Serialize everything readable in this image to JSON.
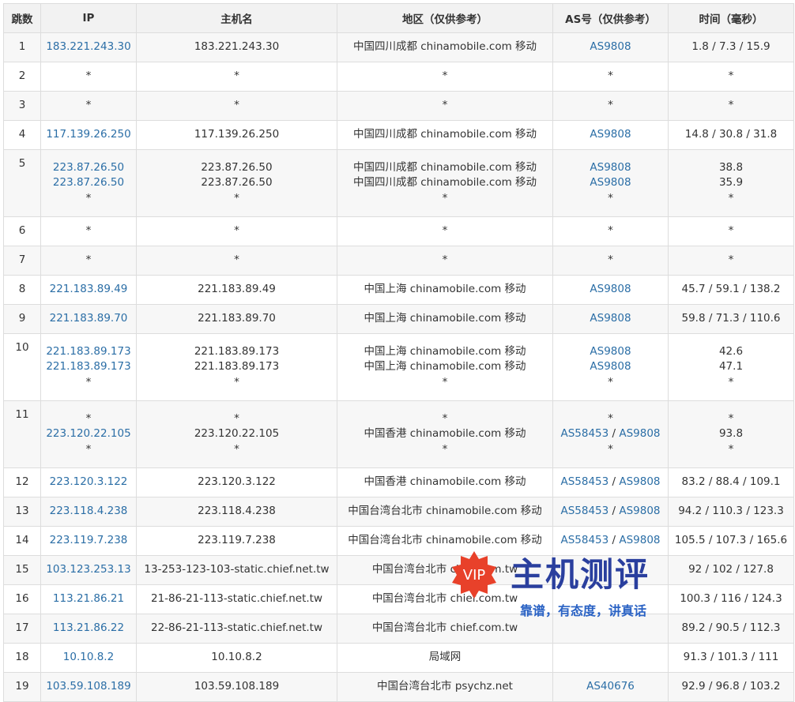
{
  "headers": [
    "跳数",
    "IP",
    "主机名",
    "地区（仅供参考）",
    "AS号（仅供参考）",
    "时间（毫秒）"
  ],
  "rows": [
    {
      "hop": "1",
      "ip": [
        "183.221.243.30"
      ],
      "host": [
        "183.221.243.30"
      ],
      "region": [
        "中国四川成都 chinamobile.com 移动"
      ],
      "as": [
        [
          "AS9808"
        ]
      ],
      "time": [
        "1.8 / 7.3 / 15.9"
      ]
    },
    {
      "hop": "2",
      "ip": [
        "*"
      ],
      "host": [
        "*"
      ],
      "region": [
        "*"
      ],
      "as": [
        [
          "*"
        ]
      ],
      "time": [
        "*"
      ]
    },
    {
      "hop": "3",
      "ip": [
        "*"
      ],
      "host": [
        "*"
      ],
      "region": [
        "*"
      ],
      "as": [
        [
          "*"
        ]
      ],
      "time": [
        "*"
      ]
    },
    {
      "hop": "4",
      "ip": [
        "117.139.26.250"
      ],
      "host": [
        "117.139.26.250"
      ],
      "region": [
        "中国四川成都 chinamobile.com 移动"
      ],
      "as": [
        [
          "AS9808"
        ]
      ],
      "time": [
        "14.8 / 30.8 / 31.8"
      ]
    },
    {
      "hop": "5",
      "ip": [
        "223.87.26.50",
        "223.87.26.50",
        "*"
      ],
      "host": [
        "223.87.26.50",
        "223.87.26.50",
        "*"
      ],
      "region": [
        "中国四川成都 chinamobile.com 移动",
        "中国四川成都 chinamobile.com 移动",
        "*"
      ],
      "as": [
        [
          "AS9808"
        ],
        [
          "AS9808"
        ],
        [
          "*"
        ]
      ],
      "time": [
        "38.8",
        "35.9",
        "*"
      ]
    },
    {
      "hop": "6",
      "ip": [
        "*"
      ],
      "host": [
        "*"
      ],
      "region": [
        "*"
      ],
      "as": [
        [
          "*"
        ]
      ],
      "time": [
        "*"
      ]
    },
    {
      "hop": "7",
      "ip": [
        "*"
      ],
      "host": [
        "*"
      ],
      "region": [
        "*"
      ],
      "as": [
        [
          "*"
        ]
      ],
      "time": [
        "*"
      ]
    },
    {
      "hop": "8",
      "ip": [
        "221.183.89.49"
      ],
      "host": [
        "221.183.89.49"
      ],
      "region": [
        "中国上海 chinamobile.com 移动"
      ],
      "as": [
        [
          "AS9808"
        ]
      ],
      "time": [
        "45.7 / 59.1 / 138.2"
      ]
    },
    {
      "hop": "9",
      "ip": [
        "221.183.89.70"
      ],
      "host": [
        "221.183.89.70"
      ],
      "region": [
        "中国上海 chinamobile.com 移动"
      ],
      "as": [
        [
          "AS9808"
        ]
      ],
      "time": [
        "59.8 / 71.3 / 110.6"
      ]
    },
    {
      "hop": "10",
      "ip": [
        "221.183.89.173",
        "221.183.89.173",
        "*"
      ],
      "host": [
        "221.183.89.173",
        "221.183.89.173",
        "*"
      ],
      "region": [
        "中国上海 chinamobile.com 移动",
        "中国上海 chinamobile.com 移动",
        "*"
      ],
      "as": [
        [
          "AS9808"
        ],
        [
          "AS9808"
        ],
        [
          "*"
        ]
      ],
      "time": [
        "42.6",
        "47.1",
        "*"
      ]
    },
    {
      "hop": "11",
      "ip": [
        "*",
        "223.120.22.105",
        "*"
      ],
      "host": [
        "*",
        "223.120.22.105",
        "*"
      ],
      "region": [
        "*",
        "中国香港 chinamobile.com 移动",
        "*"
      ],
      "as": [
        [
          "*"
        ],
        [
          "AS58453",
          "AS9808"
        ],
        [
          "*"
        ]
      ],
      "time": [
        "*",
        "93.8",
        "*"
      ]
    },
    {
      "hop": "12",
      "ip": [
        "223.120.3.122"
      ],
      "host": [
        "223.120.3.122"
      ],
      "region": [
        "中国香港 chinamobile.com 移动"
      ],
      "as": [
        [
          "AS58453",
          "AS9808"
        ]
      ],
      "time": [
        "83.2 / 88.4 / 109.1"
      ]
    },
    {
      "hop": "13",
      "ip": [
        "223.118.4.238"
      ],
      "host": [
        "223.118.4.238"
      ],
      "region": [
        "中国台湾台北市 chinamobile.com 移动"
      ],
      "as": [
        [
          "AS58453",
          "AS9808"
        ]
      ],
      "time": [
        "94.2 / 110.3 / 123.3"
      ]
    },
    {
      "hop": "14",
      "ip": [
        "223.119.7.238"
      ],
      "host": [
        "223.119.7.238"
      ],
      "region": [
        "中国台湾台北市 chinamobile.com 移动"
      ],
      "as": [
        [
          "AS58453",
          "AS9808"
        ]
      ],
      "time": [
        "105.5 / 107.3 / 165.6"
      ]
    },
    {
      "hop": "15",
      "ip": [
        "103.123.253.13"
      ],
      "host": [
        "13-253-123-103-static.chief.net.tw"
      ],
      "region": [
        "中国台湾台北市 chief.com.tw"
      ],
      "as": [
        [
          ""
        ]
      ],
      "time": [
        "92 / 102 / 127.8"
      ]
    },
    {
      "hop": "16",
      "ip": [
        "113.21.86.21"
      ],
      "host": [
        "21-86-21-113-static.chief.net.tw"
      ],
      "region": [
        "中国台湾台北市 chief.com.tw"
      ],
      "as": [
        [
          ""
        ]
      ],
      "time": [
        "100.3 / 116 / 124.3"
      ]
    },
    {
      "hop": "17",
      "ip": [
        "113.21.86.22"
      ],
      "host": [
        "22-86-21-113-static.chief.net.tw"
      ],
      "region": [
        "中国台湾台北市 chief.com.tw"
      ],
      "as": [
        [
          ""
        ]
      ],
      "time": [
        "89.2 / 90.5 / 112.3"
      ]
    },
    {
      "hop": "18",
      "ip": [
        "10.10.8.2"
      ],
      "host": [
        "10.10.8.2"
      ],
      "region": [
        "局域网"
      ],
      "as": [
        [
          ""
        ]
      ],
      "time": [
        "91.3 / 101.3 / 111"
      ]
    },
    {
      "hop": "19",
      "ip": [
        "103.59.108.189"
      ],
      "host": [
        "103.59.108.189"
      ],
      "region": [
        "中国台湾台北市 psychz.net"
      ],
      "as": [
        [
          "AS40676"
        ]
      ],
      "time": [
        "92.9 / 96.8 / 103.2"
      ]
    }
  ],
  "watermark": {
    "badge": "VIP",
    "title": "主机测评",
    "slogan": "靠谱，有态度，讲真话",
    "badge_color": "#e8412a",
    "title_color": "#2a3f9e"
  },
  "colors": {
    "link": "#2b6ea6",
    "header_bg": "#f2f2f2",
    "stripe_bg": "#f7f7f7",
    "border": "#dddddd"
  }
}
